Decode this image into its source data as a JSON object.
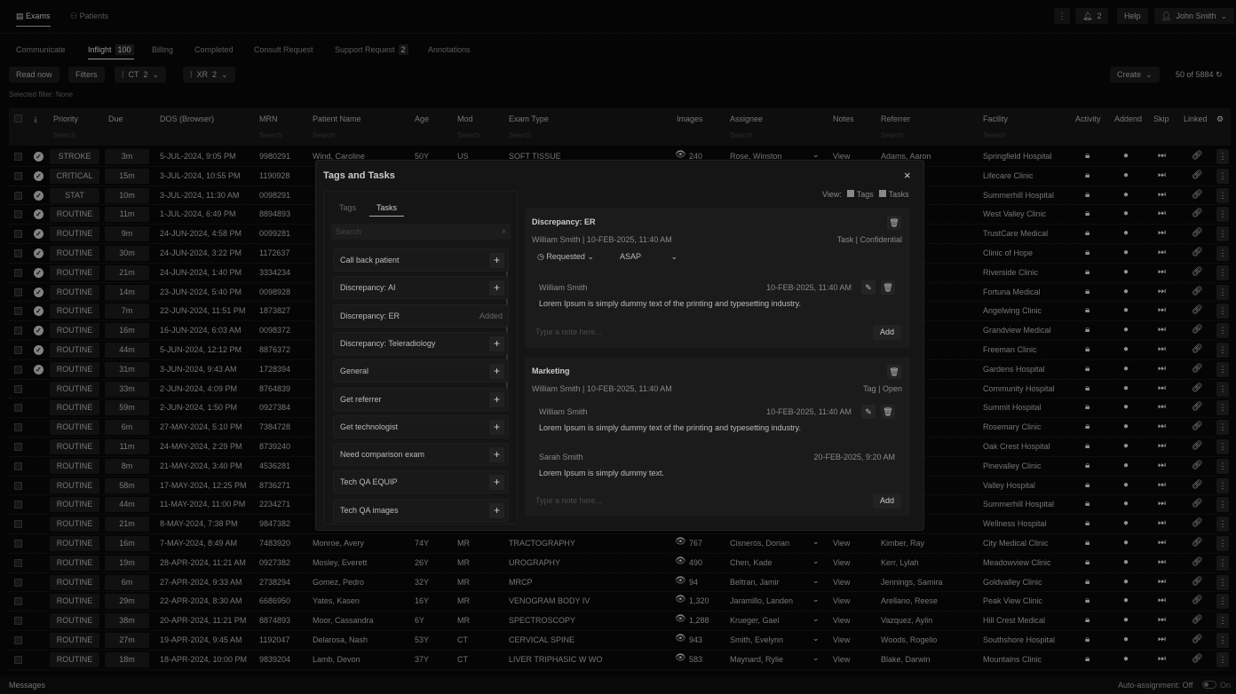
{
  "nav": {
    "exams": "Exams",
    "patients": "Patients",
    "more_icon": "more-vertical",
    "notifications": "2",
    "help": "Help",
    "user": "John Smith"
  },
  "tabs": [
    {
      "label": "Communicate"
    },
    {
      "label": "Inflight",
      "count": "100",
      "active": true
    },
    {
      "label": "Billing"
    },
    {
      "label": "Completed"
    },
    {
      "label": "Consult Request"
    },
    {
      "label": "Support Request",
      "count": "2"
    },
    {
      "label": "Annotations"
    }
  ],
  "toolbar": {
    "read_now": "Read now",
    "filters": "Filters",
    "ct": "CT",
    "ct_count": "2",
    "xr": "XR",
    "xr_count": "2",
    "create": "Create",
    "pagination": "50 of 5884",
    "selected_filter_label": "Selected filter:",
    "selected_filter_value": "None"
  },
  "columns": [
    "Priority",
    "Due",
    "DOS (Browser)",
    "MRN",
    "Patient Name",
    "Age",
    "Mod",
    "Exam Type",
    "Images",
    "Assignee",
    "Notes",
    "Referrer",
    "Facility",
    "Activity",
    "Addend",
    "Skip",
    "Linked"
  ],
  "search_placeholder": "Search",
  "rows": [
    {
      "checked": true,
      "priority": "STROKE",
      "due": "3m",
      "dos": "5-JUL-2024, 9:05 PM",
      "mrn": "9980291",
      "patient": "Wind, Caroline",
      "age": "50Y",
      "mod": "US",
      "exam": "SOFT TISSUE",
      "images": "240",
      "assignee": "Rose, Winston",
      "notes": "View",
      "referrer": "Adams, Aaron",
      "facility": "Springfield Hospital"
    },
    {
      "checked": true,
      "priority": "CRITICAL",
      "due": "15m",
      "dos": "3-JUL-2024, 10:55 PM",
      "mrn": "1190928",
      "facility": "Lifecare Clinic"
    },
    {
      "checked": true,
      "priority": "STAT",
      "due": "10m",
      "dos": "3-JUL-2024, 11:30 AM",
      "mrn": "0098291",
      "facility": "Summerhill Hospital"
    },
    {
      "checked": true,
      "priority": "ROUTINE",
      "due": "11m",
      "dos": "1-JUL-2024, 6:49 PM",
      "mrn": "8894893",
      "facility": "West Valley Clinic"
    },
    {
      "checked": true,
      "priority": "ROUTINE",
      "due": "9m",
      "dos": "24-JUN-2024, 4:58 PM",
      "mrn": "0099281",
      "facility": "TrustCare Medical"
    },
    {
      "checked": true,
      "priority": "ROUTINE",
      "due": "30m",
      "dos": "24-JUN-2024, 3:22 PM",
      "mrn": "1172637",
      "facility": "Clinic of Hope"
    },
    {
      "checked": true,
      "priority": "ROUTINE",
      "due": "21m",
      "dos": "24-JUN-2024, 1:40 PM",
      "mrn": "3334234",
      "facility": "Riverside Clinic"
    },
    {
      "checked": true,
      "priority": "ROUTINE",
      "due": "14m",
      "dos": "23-JUN-2024, 5:40 PM",
      "mrn": "0098928",
      "facility": "Fortuna Medical"
    },
    {
      "checked": true,
      "priority": "ROUTINE",
      "due": "7m",
      "dos": "22-JUN-2024, 11:51 PM",
      "mrn": "1873827",
      "facility": "Angelwing Clinic"
    },
    {
      "checked": true,
      "priority": "ROUTINE",
      "due": "16m",
      "dos": "16-JUN-2024, 6:03 AM",
      "mrn": "0098372",
      "facility": "Grandview Medical"
    },
    {
      "checked": true,
      "priority": "ROUTINE",
      "due": "44m",
      "dos": "5-JUN-2024, 12:12 PM",
      "mrn": "8876372",
      "facility": "Freeman Clinic"
    },
    {
      "checked": true,
      "priority": "ROUTINE",
      "due": "31m",
      "dos": "3-JUN-2024, 9:43 AM",
      "mrn": "1728394",
      "facility": "Gardens Hospital"
    },
    {
      "checked": false,
      "priority": "ROUTINE",
      "due": "33m",
      "dos": "2-JUN-2024, 4:09 PM",
      "mrn": "8764839",
      "facility": "Community Hospital"
    },
    {
      "checked": false,
      "priority": "ROUTINE",
      "due": "59m",
      "dos": "2-JUN-2024, 1:50 PM",
      "mrn": "0927384",
      "facility": "Summit Hospital"
    },
    {
      "checked": false,
      "priority": "ROUTINE",
      "due": "6m",
      "dos": "27-MAY-2024, 5:10 PM",
      "mrn": "7384728",
      "facility": "Rosemary Clinic"
    },
    {
      "checked": false,
      "priority": "ROUTINE",
      "due": "11m",
      "dos": "24-MAY-2024, 2:29 PM",
      "mrn": "8739240",
      "facility": "Oak Crest Hospital"
    },
    {
      "checked": false,
      "priority": "ROUTINE",
      "due": "8m",
      "dos": "21-MAY-2024, 3:40 PM",
      "mrn": "4536281",
      "facility": "Pinevalley Clinic"
    },
    {
      "checked": false,
      "priority": "ROUTINE",
      "due": "58m",
      "dos": "17-MAY-2024, 12:25 PM",
      "mrn": "8736271",
      "facility": "Valley Hospital"
    },
    {
      "checked": false,
      "priority": "ROUTINE",
      "due": "44m",
      "dos": "11-MAY-2024, 11:00 PM",
      "mrn": "2234271",
      "facility": "Summerhill Hospital"
    },
    {
      "checked": false,
      "priority": "ROUTINE",
      "due": "21m",
      "dos": "8-MAY-2024, 7:38 PM",
      "mrn": "9847382",
      "facility": "Wellness Hospital"
    },
    {
      "checked": false,
      "priority": "ROUTINE",
      "due": "16m",
      "dos": "7-MAY-2024, 8:49 AM",
      "mrn": "7483920",
      "patient": "Monroe, Avery",
      "age": "74Y",
      "mod": "MR",
      "exam": "TRACTOGRAPHY",
      "images": "767",
      "assignee": "Cisneros, Dorian",
      "notes": "View",
      "referrer": "Kimber, Ray",
      "facility": "City Medical Clinic"
    },
    {
      "checked": false,
      "priority": "ROUTINE",
      "due": "19m",
      "dos": "28-APR-2024, 11:21 AM",
      "mrn": "0927382",
      "patient": "Mosley, Everett",
      "age": "26Y",
      "mod": "MR",
      "exam": "UROGRAPHY",
      "images": "490",
      "assignee": "Chen, Kade",
      "notes": "View",
      "referrer": "Kerr, Lylah",
      "facility": "Meadowview Clinic"
    },
    {
      "checked": false,
      "priority": "ROUTINE",
      "due": "6m",
      "dos": "27-APR-2024, 9:33 AM",
      "mrn": "2738294",
      "patient": "Gomez, Pedro",
      "age": "32Y",
      "mod": "MR",
      "exam": "MRCP",
      "images": "94",
      "assignee": "Beltran, Jamir",
      "notes": "View",
      "referrer": "Jennings, Samira",
      "facility": "Goldvalley Clinic"
    },
    {
      "checked": false,
      "priority": "ROUTINE",
      "due": "29m",
      "dos": "22-APR-2024, 8:30 AM",
      "mrn": "6686950",
      "patient": "Yates, Kasen",
      "age": "16Y",
      "mod": "MR",
      "exam": "VENOGRAM BODY IV",
      "images": "1,320",
      "assignee": "Jaramillo, Landen",
      "notes": "View",
      "referrer": "Arellano, Reese",
      "facility": "Peak View Clinic"
    },
    {
      "checked": false,
      "priority": "ROUTINE",
      "due": "38m",
      "dos": "20-APR-2024, 11:21 PM",
      "mrn": "8874893",
      "patient": "Moor, Cassandra",
      "age": "6Y",
      "mod": "MR",
      "exam": "SPECTROSCOPY",
      "images": "1,288",
      "assignee": "Krueger, Gael",
      "notes": "View",
      "referrer": "Vazquez, Aylin",
      "facility": "Hill Crest Medical"
    },
    {
      "checked": false,
      "priority": "ROUTINE",
      "due": "27m",
      "dos": "19-APR-2024, 9:45 AM",
      "mrn": "1192047",
      "patient": "Delarosa, Nash",
      "age": "53Y",
      "mod": "CT",
      "exam": "CERVICAL SPINE",
      "images": "943",
      "assignee": "Smith, Evelynn",
      "notes": "View",
      "referrer": "Woods, Rogelio",
      "facility": "Southshore Hospital"
    },
    {
      "checked": false,
      "priority": "ROUTINE",
      "due": "18m",
      "dos": "18-APR-2024, 10:00 PM",
      "mrn": "9839204",
      "patient": "Lamb, Devon",
      "age": "37Y",
      "mod": "CT",
      "exam": "LIVER TRIPHASIC W WO",
      "images": "583",
      "assignee": "Maynard, Rylie",
      "notes": "View",
      "referrer": "Blake, Darwin",
      "facility": "Mountains Clinic"
    }
  ],
  "footer": {
    "messages": "Messages",
    "auto_assign": "Auto-assignment:",
    "off": "Off",
    "on": "On",
    "auto_assign_on": false
  },
  "modal": {
    "title": "Tags and Tasks",
    "tab_tags": "Tags",
    "tab_tasks": "Tasks",
    "search_placeholder": "Search",
    "view_label": "View:",
    "view_tags": "Tags",
    "view_tasks": "Tasks",
    "items": [
      {
        "label": "Call back patient"
      },
      {
        "label": "Discrepancy: AI"
      },
      {
        "label": "Discrepancy: ER",
        "status": "Added"
      },
      {
        "label": "Discrepancy: Teleradiology"
      },
      {
        "label": "General"
      },
      {
        "label": "Get referrer"
      },
      {
        "label": "Get technologist"
      },
      {
        "label": "Need comparison exam"
      },
      {
        "label": "Tech QA EQUIP"
      },
      {
        "label": "Tech QA images"
      }
    ],
    "cards": [
      {
        "title": "Discrepancy: ER",
        "meta": "William Smith | 10-FEB-2025, 11:40 AM",
        "type": "Task | Confidential",
        "status": "Requested",
        "urgency": "ASAP",
        "notes": [
          {
            "author": "William Smith",
            "time": "10-FEB-2025, 11:40 AM",
            "text": "Lorem Ipsum is simply dummy text of the printing and typesetting industry."
          }
        ]
      },
      {
        "title": "Marketing",
        "meta": "William Smith | 10-FEB-2025, 11:40 AM",
        "type": "Tag | Open",
        "notes": [
          {
            "author": "William Smith",
            "time": "10-FEB-2025, 11:40 AM",
            "text": "Lorem Ipsum is simply dummy text of the printing and typesetting industry."
          },
          {
            "author": "Sarah Smith",
            "time": "20-FEB-2025, 9:20 AM",
            "text": "Lorem Ipsum is simply dummy text."
          }
        ]
      }
    ],
    "note_placeholder": "Type a note here...",
    "add": "Add"
  }
}
